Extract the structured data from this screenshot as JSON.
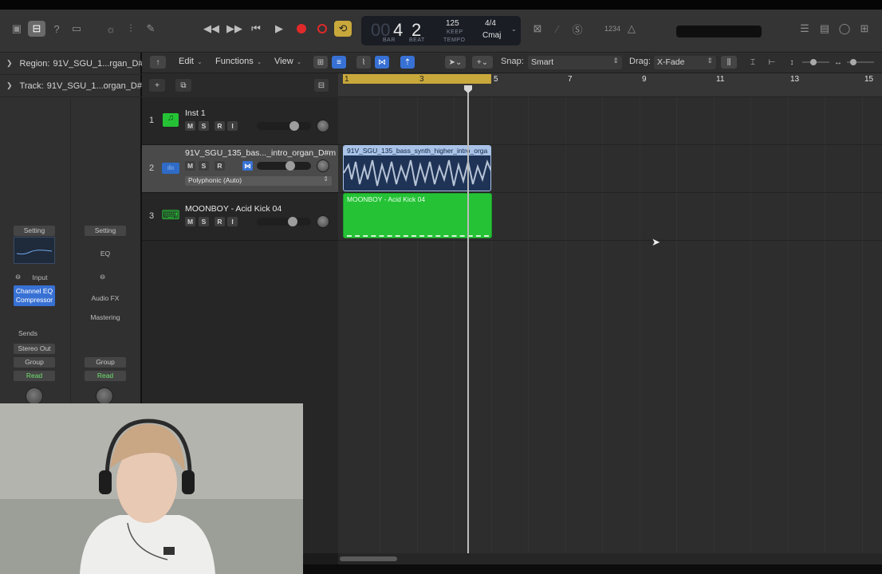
{
  "toolbar": {
    "lcd": {
      "bar": "4",
      "beat": "2",
      "bar_ghost": "00",
      "bar_label": "BAR",
      "beat_label": "BEAT",
      "tempo": "125",
      "tempo_mode": "KEEP",
      "tempo_label": "TEMPO",
      "signature": "4/4",
      "key": "Cmaj"
    },
    "count_in": "1234"
  },
  "inspector": {
    "region_label": "Region:",
    "region_value": "91V_SGU_1...rgan_D#m",
    "track_label": "Track:",
    "track_value": "91V_SGU_1...organ_D#m",
    "strip1": {
      "setting": "Setting",
      "input": "Input",
      "plugin1": "Channel EQ",
      "plugin2": "Compressor",
      "sends": "Sends",
      "output": "Stereo Out",
      "group": "Group",
      "automation": "Read"
    },
    "strip2": {
      "setting": "Setting",
      "eq": "EQ",
      "audio_fx": "Audio FX",
      "mastering": "Mastering",
      "group": "Group",
      "automation": "Read"
    }
  },
  "tracks_toolbar": {
    "edit": "Edit",
    "functions": "Functions",
    "view": "View",
    "snap_label": "Snap:",
    "snap_value": "Smart",
    "drag_label": "Drag:",
    "drag_value": "X-Fade"
  },
  "ruler": {
    "bars": [
      "1",
      "3",
      "5",
      "7",
      "9",
      "11",
      "13",
      "15"
    ]
  },
  "tracks": [
    {
      "number": "1",
      "name": "Inst 1",
      "m": "M",
      "s": "S",
      "r": "R",
      "i": "I"
    },
    {
      "number": "2",
      "name": "91V_SGU_135_bas..._intro_organ_D#m",
      "m": "M",
      "s": "S",
      "r": "R",
      "i": "I",
      "flex_mode": "Polyphonic (Auto)"
    },
    {
      "number": "3",
      "name": "MOONBOY - Acid Kick 04",
      "m": "M",
      "s": "S",
      "r": "R",
      "i": "I"
    }
  ],
  "regions": [
    {
      "title": "91V_SGU_135_bass_synth_higher_intro_orga",
      "color": "#a9c3e8"
    },
    {
      "title": "MOONBOY - Acid Kick 04",
      "color": "#25c236"
    }
  ],
  "colors": {
    "accent_blue": "#3871d4",
    "cycle": "#c9a83b",
    "record": "#e02a2a",
    "midi_green": "#25c236"
  }
}
